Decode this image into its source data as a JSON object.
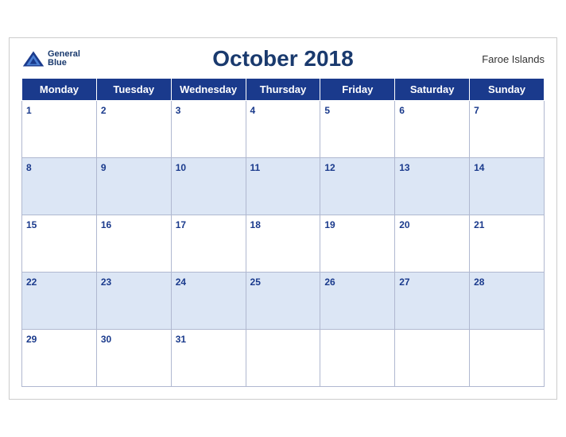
{
  "calendar": {
    "month_title": "October 2018",
    "region": "Faroe Islands",
    "logo": {
      "general": "General",
      "blue": "Blue"
    },
    "days_of_week": [
      "Monday",
      "Tuesday",
      "Wednesday",
      "Thursday",
      "Friday",
      "Saturday",
      "Sunday"
    ],
    "weeks": [
      [
        1,
        2,
        3,
        4,
        5,
        6,
        7
      ],
      [
        8,
        9,
        10,
        11,
        12,
        13,
        14
      ],
      [
        15,
        16,
        17,
        18,
        19,
        20,
        21
      ],
      [
        22,
        23,
        24,
        25,
        26,
        27,
        28
      ],
      [
        29,
        30,
        31,
        null,
        null,
        null,
        null
      ]
    ]
  }
}
